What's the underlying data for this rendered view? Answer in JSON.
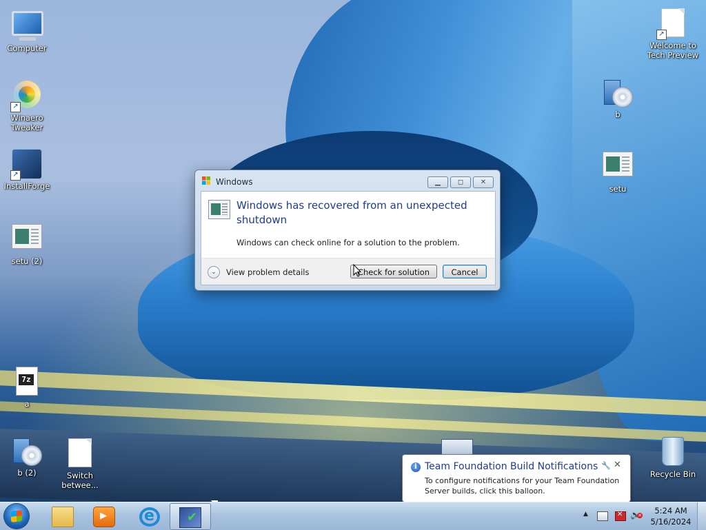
{
  "desktop": {
    "icons": [
      {
        "label": "Computer"
      },
      {
        "label": "Winaero Tweaker"
      },
      {
        "label": "InstallForge"
      },
      {
        "label": "setu (2)"
      },
      {
        "label": "a"
      },
      {
        "label": "b (2)"
      },
      {
        "label": "Switch betwee..."
      },
      {
        "label": "Welcome to Tech Preview"
      },
      {
        "label": "b"
      },
      {
        "label": "setu"
      },
      {
        "label": "Recycle Bin"
      }
    ]
  },
  "dialog": {
    "title": "Windows",
    "heading": "Windows has recovered from an unexpected shutdown",
    "body": "Windows can check online for a solution to the problem.",
    "details_label": "View problem details",
    "check_button": "Check for solution",
    "cancel_button": "Cancel"
  },
  "balloon": {
    "title": "Team Foundation Build Notifications",
    "text": "To configure notifications for your Team Foundation Server builds, click this balloon."
  },
  "taskbar": {
    "time": "5:24 AM",
    "date": "5/16/2024"
  },
  "icons": {
    "start": "windows-logo-icon",
    "pinned": [
      "folder-icon",
      "media-player-icon",
      "internet-explorer-icon",
      "setup-check-icon"
    ],
    "tray": [
      "chevron-up-icon",
      "network-icon",
      "build-notification-icon",
      "volume-muted-icon"
    ]
  }
}
